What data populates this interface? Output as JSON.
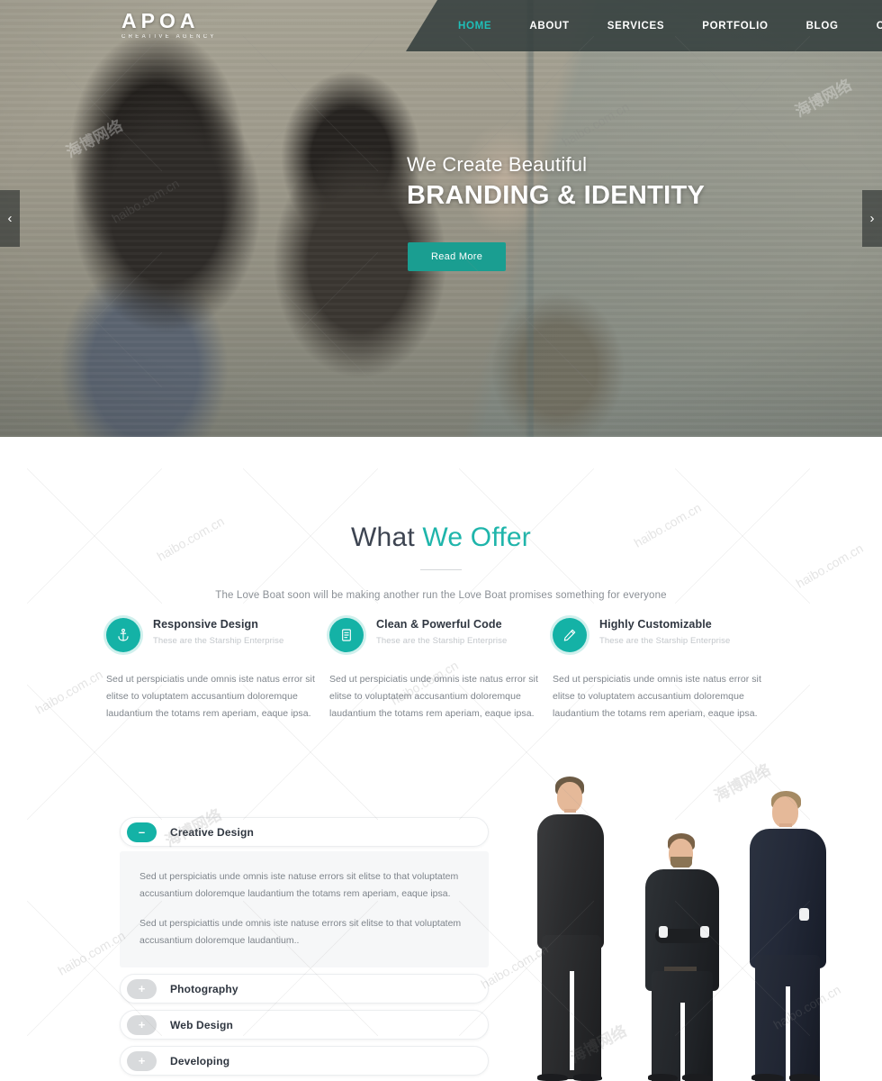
{
  "header": {
    "logo_main": "APOA",
    "logo_sub": "CREATIVE AGENCY",
    "nav": [
      {
        "label": "HOME",
        "active": true
      },
      {
        "label": "ABOUT",
        "active": false
      },
      {
        "label": "SERVICES",
        "active": false
      },
      {
        "label": "PORTFOLIO",
        "active": false
      },
      {
        "label": "BLOG",
        "active": false
      },
      {
        "label": "CONTACT",
        "active": false
      }
    ]
  },
  "hero": {
    "subtitle": "We Create Beautiful",
    "title": "BRANDING & IDENTITY",
    "button_label": "Read More",
    "prev_arrow": "‹",
    "next_arrow": "›"
  },
  "offer": {
    "heading_plain": "What ",
    "heading_accent": "We Offer",
    "description": "The Love Boat soon will be making another run the Love Boat promises something for everyone",
    "features": [
      {
        "icon": "anchor-icon",
        "title": "Responsive Design",
        "subtitle": "These are the Starship Enterprise",
        "body": "Sed ut perspiciatis unde omnis iste natus error sit elitse to voluptatem accusantium doloremque laudantium the totams rem aperiam, eaque ipsa."
      },
      {
        "icon": "document-icon",
        "title": "Clean & Powerful Code",
        "subtitle": "These are the Starship Enterprise",
        "body": "Sed ut perspiciatis unde omnis iste natus error sit elitse to voluptatem accusantium doloremque laudantium the totams rem aperiam, eaque ipsa."
      },
      {
        "icon": "pencil-icon",
        "title": "Highly Customizable",
        "subtitle": "These are the Starship Enterprise",
        "body": "Sed ut perspiciatis unde omnis iste natus error sit elitse to voluptatem accusantium doloremque laudantium the totams rem aperiam, eaque ipsa."
      }
    ]
  },
  "accordion": {
    "items": [
      {
        "label": "Creative Design",
        "open": true,
        "toggle": "–",
        "paragraphs": [
          "Sed ut perspiciatis unde omnis iste natuse errors sit elitse to that voluptatem accusantium doloremque laudantium the totams rem aperiam, eaque ipsa.",
          "Sed ut perspiciattis unde omnis iste natuse errors sit elitse to that voluptatem accusantium doloremque laudantium.."
        ]
      },
      {
        "label": "Photography",
        "open": false,
        "toggle": "+",
        "paragraphs": []
      },
      {
        "label": "Web Design",
        "open": false,
        "toggle": "+",
        "paragraphs": []
      },
      {
        "label": "Developing",
        "open": false,
        "toggle": "+",
        "paragraphs": []
      }
    ]
  },
  "watermarks": {
    "latin": "haibo.com.cn",
    "cjk": "海博网络"
  },
  "colors": {
    "accent_teal": "#14b2a6",
    "nav_active": "#1fbfb8",
    "button_teal": "#1a9e91",
    "nav_bg": "#343f3d",
    "heading_dark": "#3d4451",
    "body_gray": "#7e848b"
  }
}
